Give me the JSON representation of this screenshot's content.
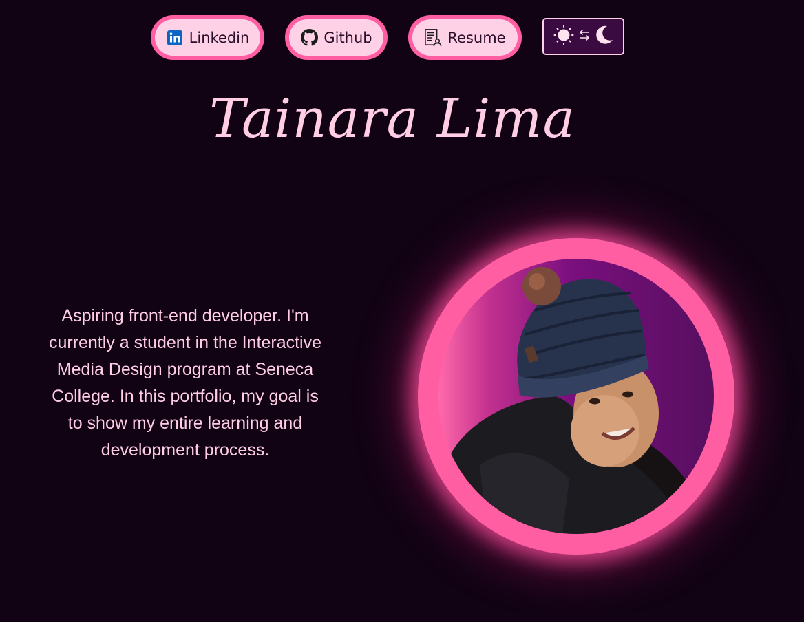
{
  "nav": {
    "linkedin": {
      "label": "Linkedin",
      "icon": "linkedin-icon",
      "icon_color": "#0a66c2"
    },
    "github": {
      "label": "Github",
      "icon": "github-icon"
    },
    "resume": {
      "label": "Resume",
      "icon": "resume-document-icon"
    }
  },
  "theme_toggle": {
    "icons": [
      "sun-icon",
      "swap-arrows-icon",
      "moon-icon"
    ]
  },
  "header": {
    "name": "Tainara Lima"
  },
  "bio": {
    "text": "Aspiring front-end developer. I'm currently a student in the Interactive Media Design program at Seneca College. In this portfolio, my goal is to show my entire learning and development process."
  },
  "profile_photo": {
    "alt": "Profile photo"
  },
  "colors": {
    "background": "#110314",
    "accent_pink": "#ff5fa2",
    "light_pink": "#ffd1e6",
    "text_pink": "#ffcde4",
    "toggle_bg": "#3a0b40"
  }
}
